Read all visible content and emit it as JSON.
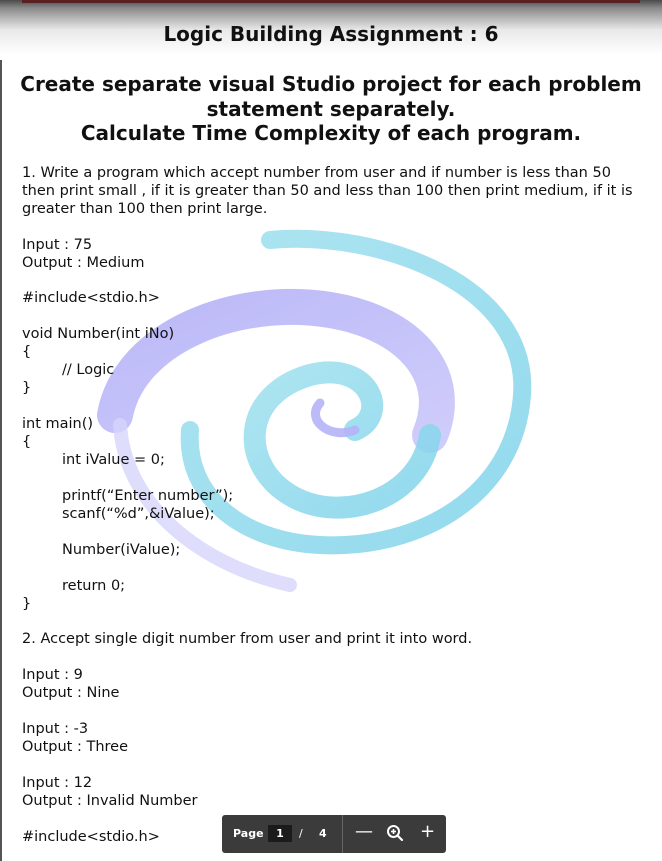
{
  "document": {
    "title": "Logic Building Assignment :  6",
    "heading_lines": [
      "Create separate visual Studio project for each problem",
      "statement separately.",
      "Calculate Time Complexity of each program."
    ],
    "problem1": {
      "statement_lines": [
        "1. Write a program which accept number from user and if number is less than 50",
        "then print small , if it is greater than 50 and less than 100 then print medium, if it is",
        "greater than 100 then print large."
      ],
      "input": "Input : 75",
      "output": "Output : Medium",
      "code": {
        "include": "#include<stdio.h>",
        "func_sig": "void Number(int iNo)",
        "open1": "{",
        "comment": "// Logic",
        "close1": "}",
        "main_sig": "int main()",
        "open2": "{",
        "decl": "int iValue = 0;",
        "printf": "printf(“Enter number”);",
        "scanf": "scanf(“%d”,&iValue);",
        "call": "Number(iValue);",
        "ret": "return 0;",
        "close2": "}"
      }
    },
    "problem2": {
      "statement": "2. Accept single digit number from user and print it into word.",
      "examples": [
        {
          "input": "Input : 9",
          "output": "Output : Nine"
        },
        {
          "input": "Input : -3",
          "output": "Output : Three"
        },
        {
          "input": "Input : 12",
          "output": "Output : Invalid Number"
        }
      ],
      "include": "#include<stdio.h>"
    }
  },
  "toolbar": {
    "page_label": "Page",
    "current_page": "1",
    "separator": "/",
    "total_pages": "4",
    "zoom_out": "—",
    "zoom_icon": "⊕",
    "zoom_in": "+"
  },
  "colors": {
    "swirl_purple": "#a9a6f5",
    "swirl_cyan": "#8fd9ea",
    "toolbar_bg": "#3b3b3b"
  }
}
